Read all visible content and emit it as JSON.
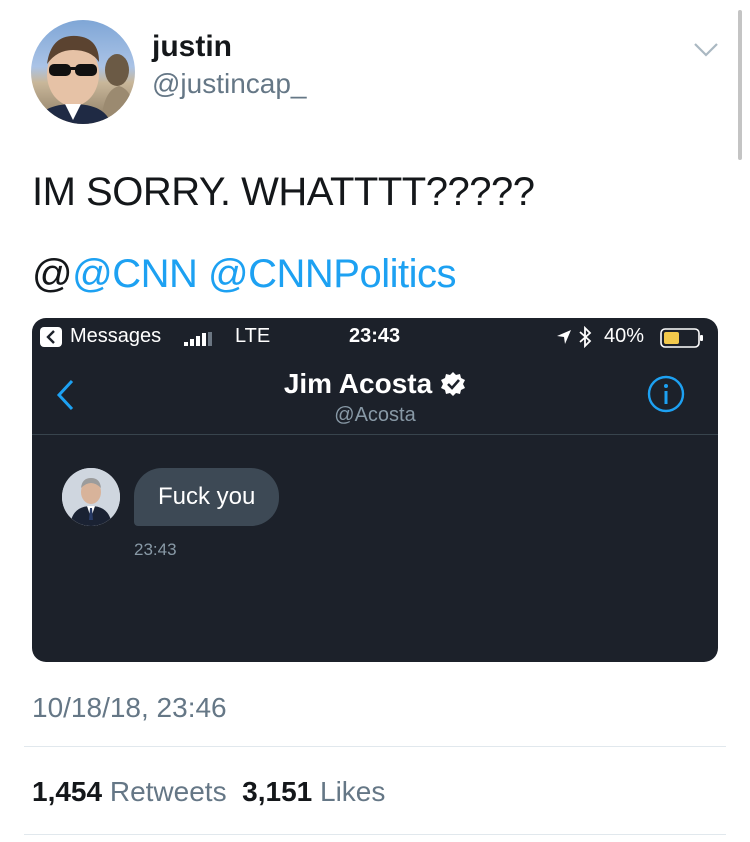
{
  "header": {
    "display_name": "justin",
    "handle": "@justincap_",
    "menu_icon": "chevron-down-icon"
  },
  "tweet": {
    "text": "IM SORRY. WHATTTT?????",
    "mention_prefix": "@",
    "mentions": [
      "@CNN",
      "@CNNPolitics"
    ]
  },
  "screenshot": {
    "status_bar": {
      "back_app": "Messages",
      "network": "LTE",
      "time": "23:43",
      "battery": "40%"
    },
    "conversation": {
      "name": "Jim Acosta",
      "handle": "@Acosta",
      "verified": true,
      "messages": [
        {
          "text": "Fuck you",
          "time": "23:43"
        }
      ]
    }
  },
  "footer": {
    "timestamp": "10/18/18, 23:46",
    "retweets_count": "1,454",
    "retweets_label": "Retweets",
    "likes_count": "3,151",
    "likes_label": "Likes"
  },
  "colors": {
    "accent": "#1da1f2",
    "muted": "#657786",
    "dm_background": "#1c212a",
    "bubble": "#3d4955"
  }
}
